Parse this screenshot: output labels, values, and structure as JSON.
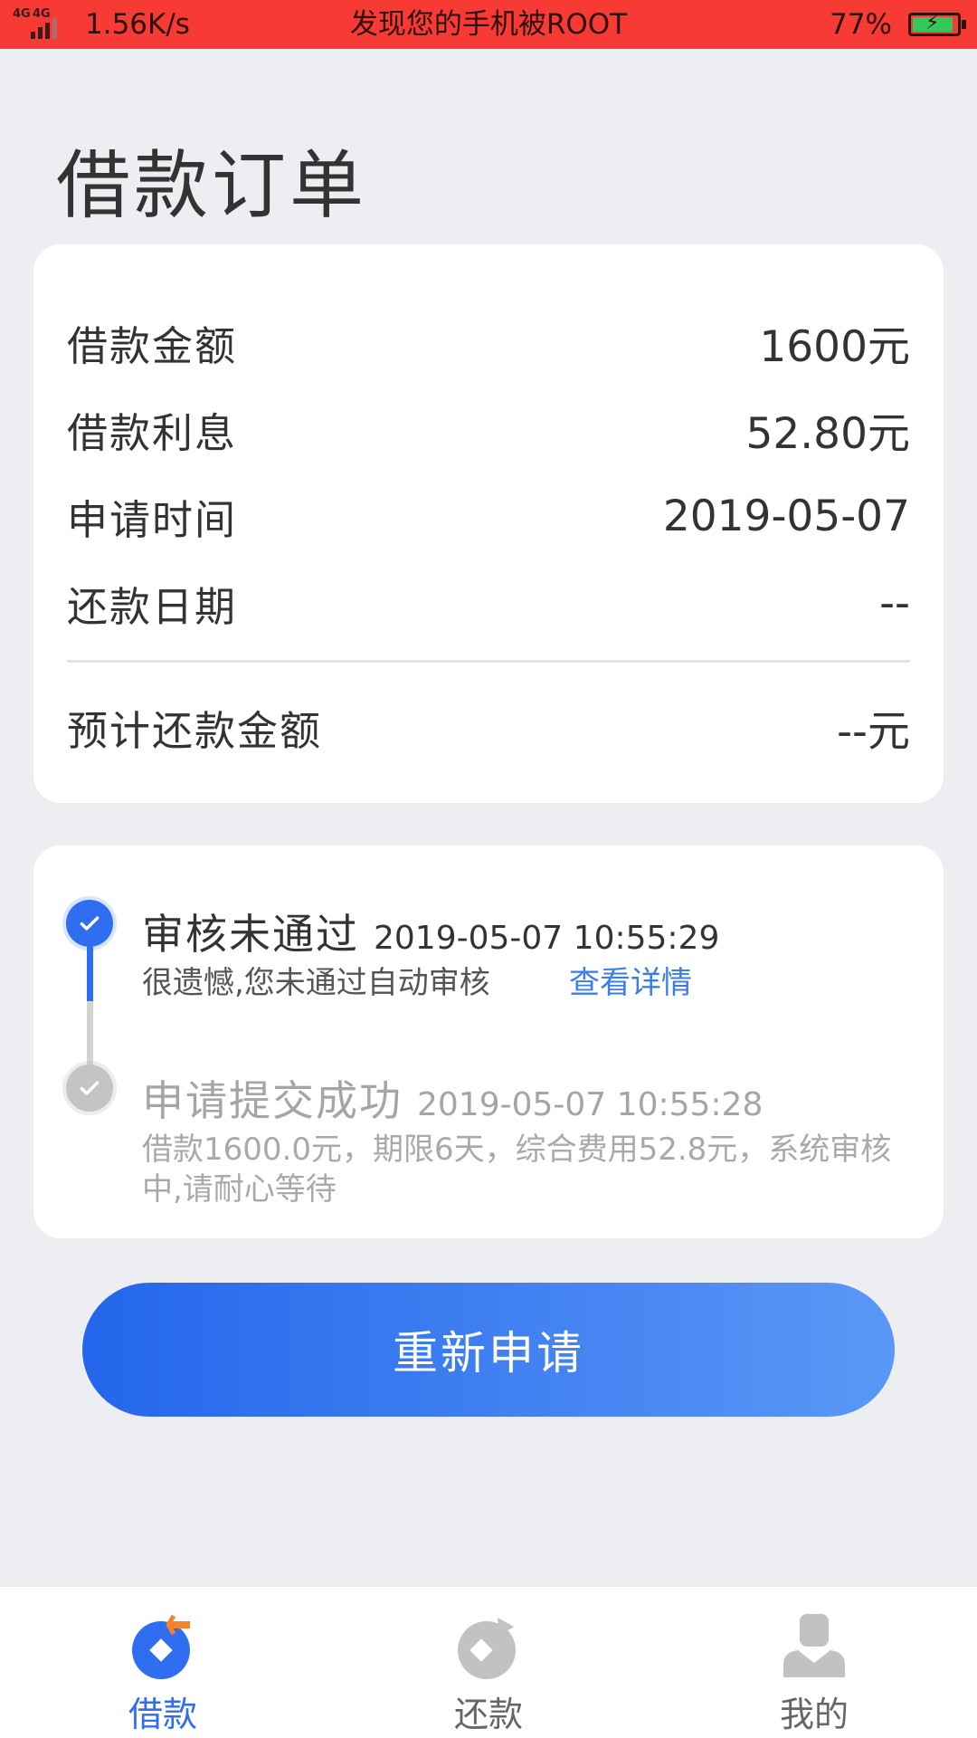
{
  "status_bar": {
    "network_left": "4G",
    "network_right": "4G",
    "speed": "1.56K/s",
    "warning": "发现您的手机被ROOT",
    "battery_percent": "77%",
    "battery_level": 0.77
  },
  "header": {
    "title": "借款订单"
  },
  "summary": {
    "rows": [
      {
        "label": "借款金额",
        "value": "1600元"
      },
      {
        "label": "借款利息",
        "value": "52.80元"
      },
      {
        "label": "申请时间",
        "value": "2019-05-07"
      },
      {
        "label": "还款日期",
        "value": "--"
      }
    ],
    "expected_repayment": {
      "label": "预计还款金额",
      "value": "--元"
    }
  },
  "timeline": {
    "steps": [
      {
        "name": "审核未通过",
        "time": "2019-05-07 10:55:29",
        "description": "很遗憾,您未通过自动审核",
        "link": "查看详情",
        "state": "current"
      },
      {
        "name": "申请提交成功",
        "time": "2019-05-07 10:55:28",
        "description": "借款1600.0元，期限6天，综合费用52.8元，系统审核中,请耐心等待",
        "state": "done"
      }
    ]
  },
  "actions": {
    "reapply_label": "重新申请"
  },
  "tab_bar": {
    "items": [
      {
        "label": "借款",
        "icon": "borrow-icon",
        "active": true
      },
      {
        "label": "还款",
        "icon": "repay-icon",
        "active": false
      },
      {
        "label": "我的",
        "icon": "profile-icon",
        "active": false
      }
    ]
  },
  "colors": {
    "accent": "#2f6ef0",
    "status_bar": "#f83a35",
    "link": "#3b7ee8",
    "background": "#eceef1"
  }
}
